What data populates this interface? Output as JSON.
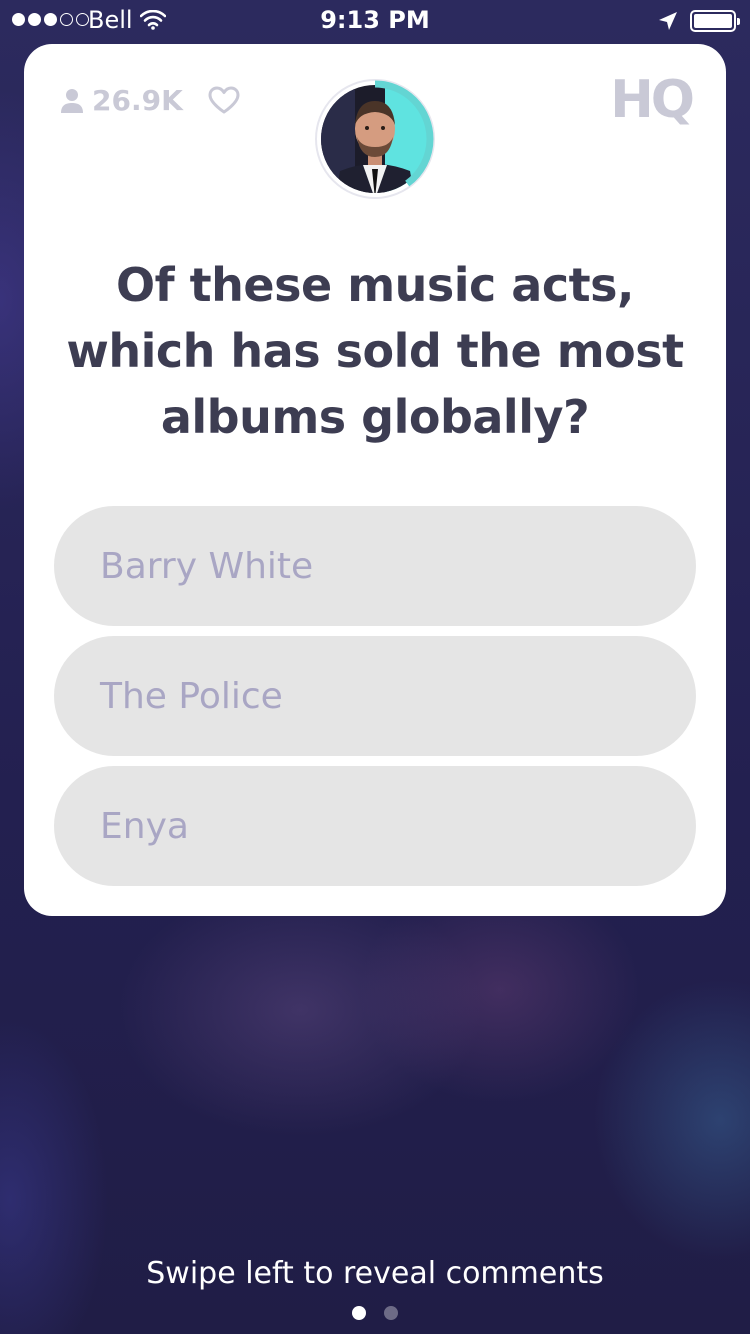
{
  "status_bar": {
    "carrier": "Bell",
    "time": "9:13 PM",
    "signal_bars_filled": 3,
    "signal_bars_total": 5
  },
  "header": {
    "viewer_count": "26.9K",
    "logo": "HQ",
    "icons": [
      "person-icon",
      "heart-icon",
      "host-avatar-timer"
    ],
    "timer_fraction_remaining": 0.4
  },
  "question": {
    "text": "Of these music acts, which has sold the most albums globally?"
  },
  "answers": [
    {
      "label": "Barry White"
    },
    {
      "label": "The Police"
    },
    {
      "label": "Enya"
    }
  ],
  "footer": {
    "swipe_hint": "Swipe left to reveal comments",
    "page_count": 2,
    "active_page": 1
  },
  "colors": {
    "background": "#26244f",
    "card": "#ffffff",
    "question_text": "#3d3d52",
    "answer_bg": "#e5e5e5",
    "answer_text": "#a9a6c4",
    "timer_accent": "#63d5d3",
    "muted": "#c9c9d6"
  }
}
